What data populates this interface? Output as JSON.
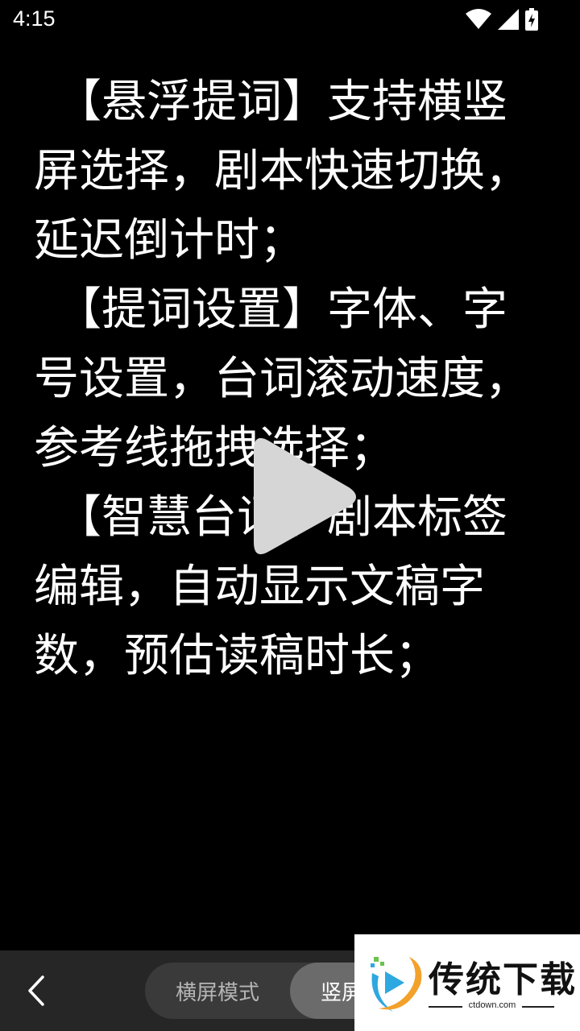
{
  "status_bar": {
    "time": "4:15",
    "icons": [
      "wifi-icon",
      "signal-icon",
      "battery-charging-icon"
    ]
  },
  "prompter": {
    "paragraphs": [
      "【悬浮提词】支持横竖屏选择，剧本快速切换，延迟倒计时；",
      "【提词设置】字体、字号设置，台词滚动速度，参考线拖拽选择；",
      "【智慧台词】剧本标签编辑，自动显示文稿字数，预估读稿时长；"
    ]
  },
  "play_overlay": {
    "icon": "play-icon"
  },
  "bottom_bar": {
    "back_icon": "chevron-left-icon",
    "modes": {
      "landscape": "横屏模式",
      "portrait": "竖屏"
    }
  },
  "watermark": {
    "title": "传统下载",
    "url": "ctdown.com"
  }
}
